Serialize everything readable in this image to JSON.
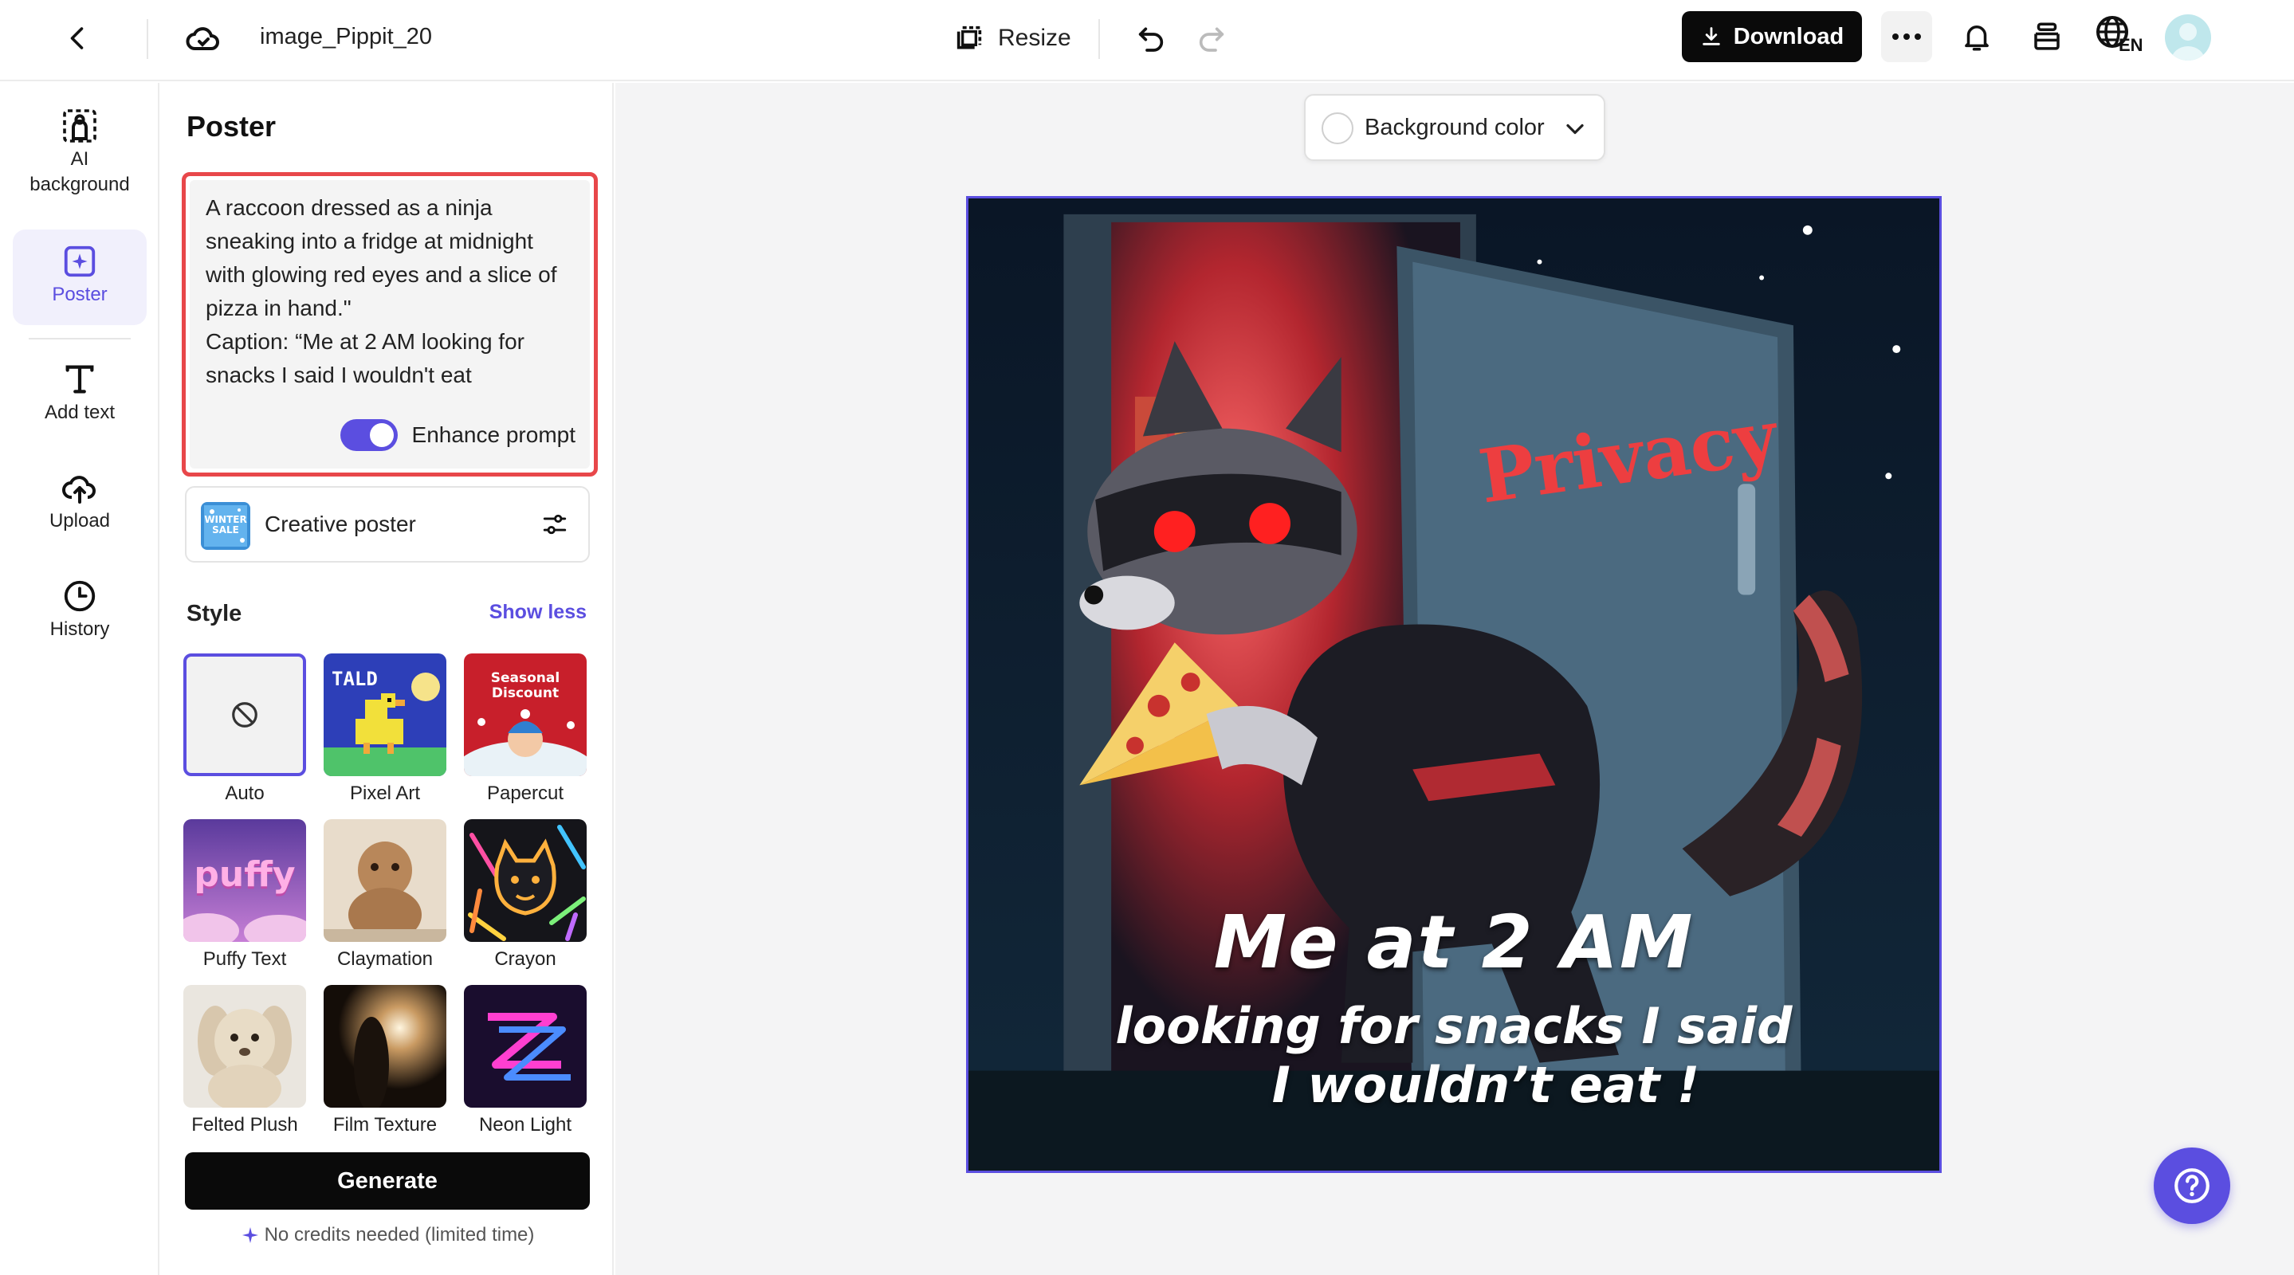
{
  "header": {
    "filename": "image_Pippit_20",
    "resize_label": "Resize",
    "download_label": "Download",
    "language_code": "EN"
  },
  "rail": {
    "items": [
      {
        "label": "AI background",
        "icon": "ai-background-icon"
      },
      {
        "label": "Poster",
        "icon": "poster-icon",
        "active": true
      },
      {
        "label": "Add text",
        "icon": "text-icon"
      },
      {
        "label": "Upload",
        "icon": "upload-cloud-icon"
      },
      {
        "label": "History",
        "icon": "clock-icon"
      }
    ]
  },
  "panel": {
    "title": "Poster",
    "prompt": "A raccoon dressed as a ninja sneaking into a fridge at midnight with glowing red eyes and a slice of pizza in hand.\"\nCaption: “Me at 2 AM looking for snacks I said I wouldn't eat",
    "enhance_label": "Enhance prompt",
    "enhance_on": true,
    "creative_poster_label": "Creative poster",
    "creative_thumb_text": "WINTER SALE",
    "style_title": "Style",
    "show_less": "Show less",
    "styles": [
      {
        "label": "Auto",
        "selected": true
      },
      {
        "label": "Pixel Art",
        "thumb_text": "TALD"
      },
      {
        "label": "Papercut",
        "thumb_text": "Seasonal Discount"
      },
      {
        "label": "Puffy Text",
        "thumb_text": "puffy"
      },
      {
        "label": "Claymation"
      },
      {
        "label": "Crayon"
      },
      {
        "label": "Felted Plush"
      },
      {
        "label": "Film Texture"
      },
      {
        "label": "Neon Light"
      }
    ],
    "generate_label": "Generate",
    "credits_note": "No credits needed (limited time)"
  },
  "canvas": {
    "background_color_label": "Background color",
    "poster": {
      "sign_text": "Privacy",
      "caption_line1": "Me at 2 AM",
      "caption_line2": "looking for snacks I said",
      "caption_line3": "I wouldn’t eat !"
    }
  },
  "colors": {
    "accent": "#5b4ee0",
    "highlight_border": "#e8474a",
    "primary_button": "#0a0a0a"
  }
}
